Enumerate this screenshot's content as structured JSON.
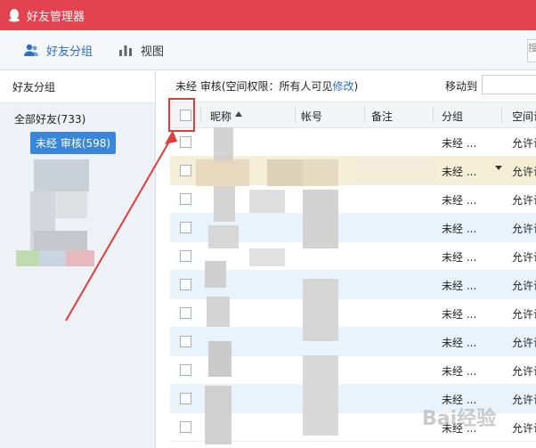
{
  "window": {
    "title": "好友管理器"
  },
  "toolbar": {
    "friends_group_label": "好友分组",
    "view_label": "视图",
    "search_hint": "搜"
  },
  "left": {
    "header": "好友分组",
    "all_friends": "全部好友(733)",
    "pending_group": "未经 审核(598)"
  },
  "main": {
    "permission_prefix": "未经 审核(空间权限：所有人可见",
    "permission_link": "修改",
    "permission_suffix": ")",
    "move_to_label": "移动到"
  },
  "table": {
    "headers": {
      "nickname": "昵称",
      "account": "帐号",
      "remark": "备注",
      "group": "分组",
      "space": "空间访"
    },
    "rows": [
      {
        "group": "未经 ...",
        "space": "允许访"
      },
      {
        "group": "未经 ...",
        "space": "允许访"
      },
      {
        "group": "未经 ...",
        "space": "允许访"
      },
      {
        "group": "未经 ...",
        "space": "允许访"
      },
      {
        "group": "未经 ...",
        "space": "允许访"
      },
      {
        "group": "未经 ...",
        "space": "允许访"
      },
      {
        "group": "未经 ...",
        "space": "允许访"
      },
      {
        "group": "未经 ...",
        "space": "允许访"
      },
      {
        "group": "未经 ...",
        "space": "允许访"
      },
      {
        "group": "未经 ...",
        "space": "允许访"
      },
      {
        "group": "未经 ...",
        "space": "允许访"
      }
    ]
  },
  "watermark": "Bai经验",
  "colors": {
    "titlebar": "#e2434f",
    "accent": "#2b6fc4",
    "selected_group": "#3a87d9",
    "annotation": "#e23b3b"
  }
}
